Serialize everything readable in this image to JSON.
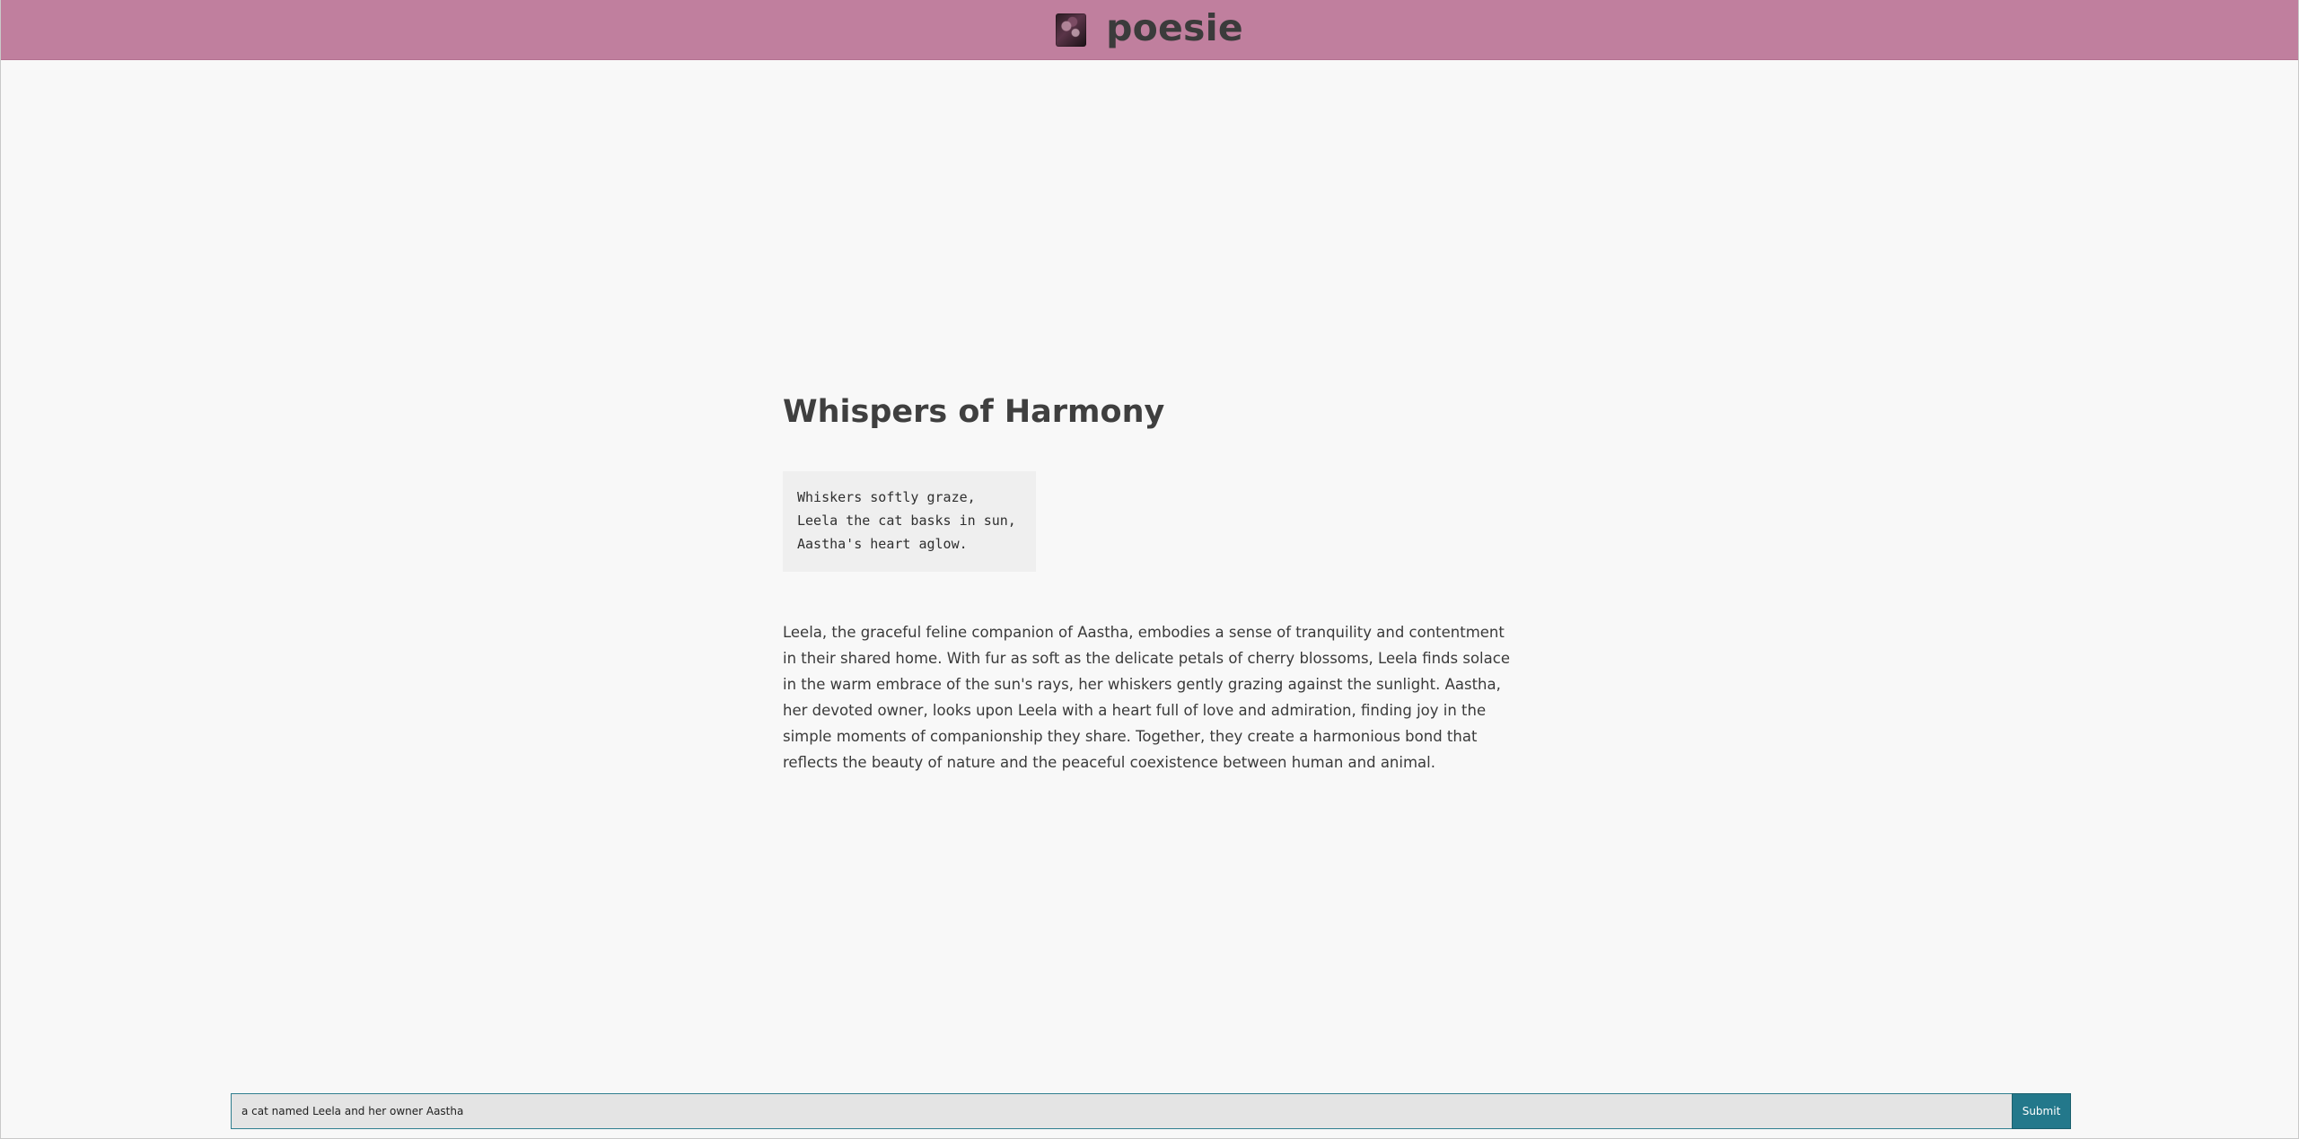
{
  "header": {
    "app_name": "poesie",
    "logo_icon": "poesie-logo-icon",
    "background_color": "#c07f9e"
  },
  "main": {
    "title": "Whispers of Harmony",
    "poem": {
      "lines": [
        "Whiskers softly graze,",
        "Leela the cat basks in sun,",
        "Aastha's heart aglow."
      ]
    },
    "description": "Leela, the graceful feline companion of Aastha, embodies a sense of tranquility and contentment in their shared home. With fur as soft as the delicate petals of cherry blossoms, Leela finds solace in the warm embrace of the sun's rays, her whiskers gently grazing against the sunlight. Aastha, her devoted owner, looks upon Leela with a heart full of love and admiration, finding joy in the simple moments of companionship they share. Together, they create a harmonious bond that reflects the beauty of nature and the peaceful coexistence between human and animal."
  },
  "prompt_form": {
    "input_value": "a cat named Leela and her owner Aastha",
    "submit_label": "Submit",
    "accent_color": "#23788b"
  }
}
